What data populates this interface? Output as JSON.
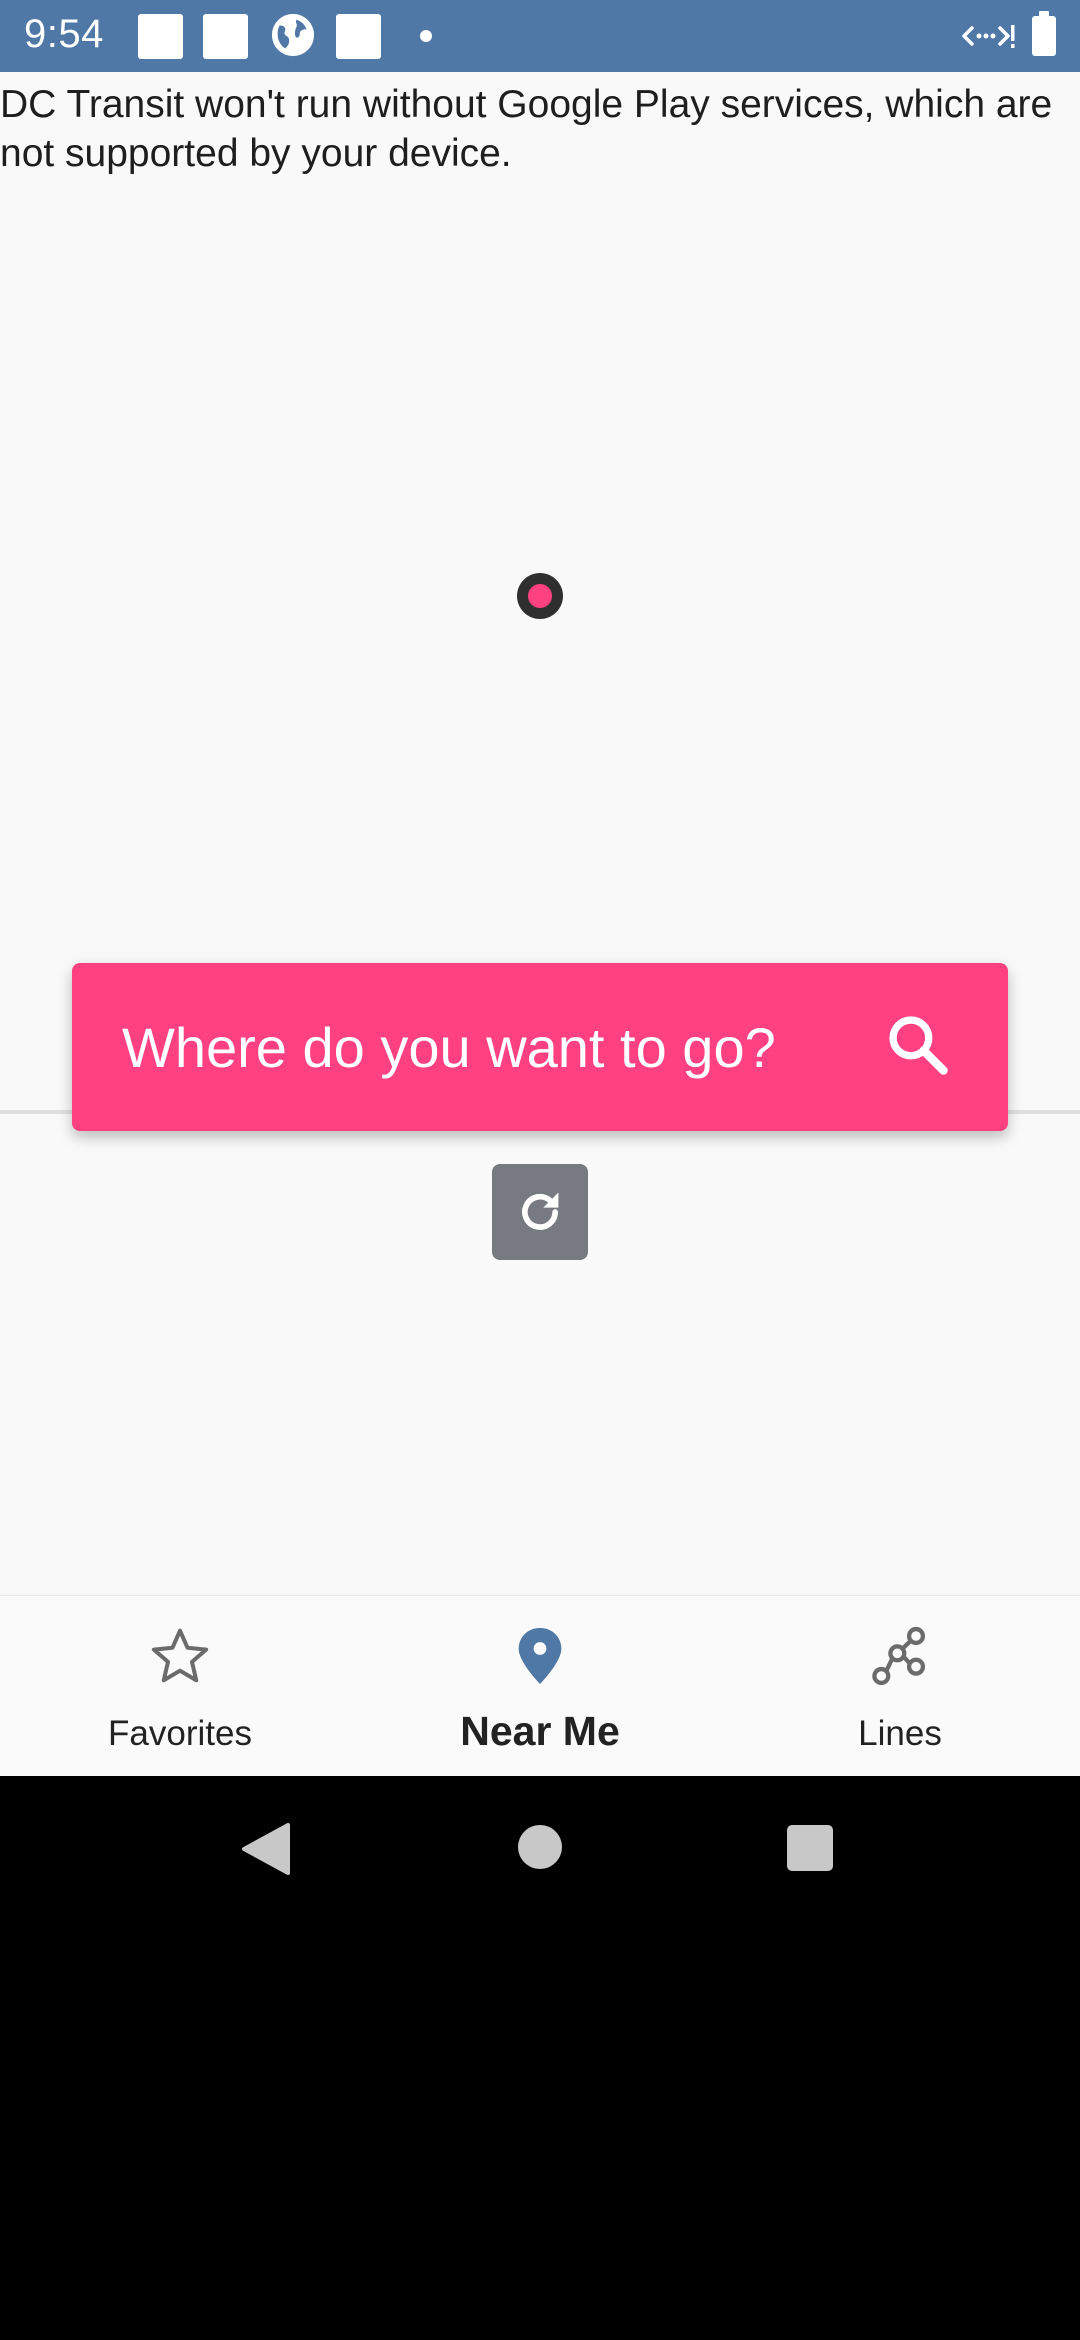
{
  "status_bar": {
    "time": "9:54",
    "icons": [
      "notification-square",
      "notification-square",
      "globe-icon",
      "notification-square",
      "dot",
      "signal-icon",
      "battery-icon"
    ]
  },
  "main": {
    "message": "DC Transit won't run without Google Play services, which are not supported by your device."
  },
  "search": {
    "placeholder": "Where do you want to go?",
    "icon": "search-icon"
  },
  "map": {
    "refresh_icon": "refresh-icon"
  },
  "bottom_nav": {
    "items": [
      {
        "label": "Favorites",
        "icon": "star-icon",
        "active": false
      },
      {
        "label": "Near Me",
        "icon": "location-pin-icon",
        "active": true
      },
      {
        "label": "Lines",
        "icon": "route-nodes-icon",
        "active": false
      }
    ]
  },
  "colors": {
    "status_bar": "#4f78a6",
    "accent": "#ff4081",
    "active_icon": "#4f78a6",
    "inactive_icon": "#6b6b6b",
    "refresh_button": "#777a80"
  }
}
